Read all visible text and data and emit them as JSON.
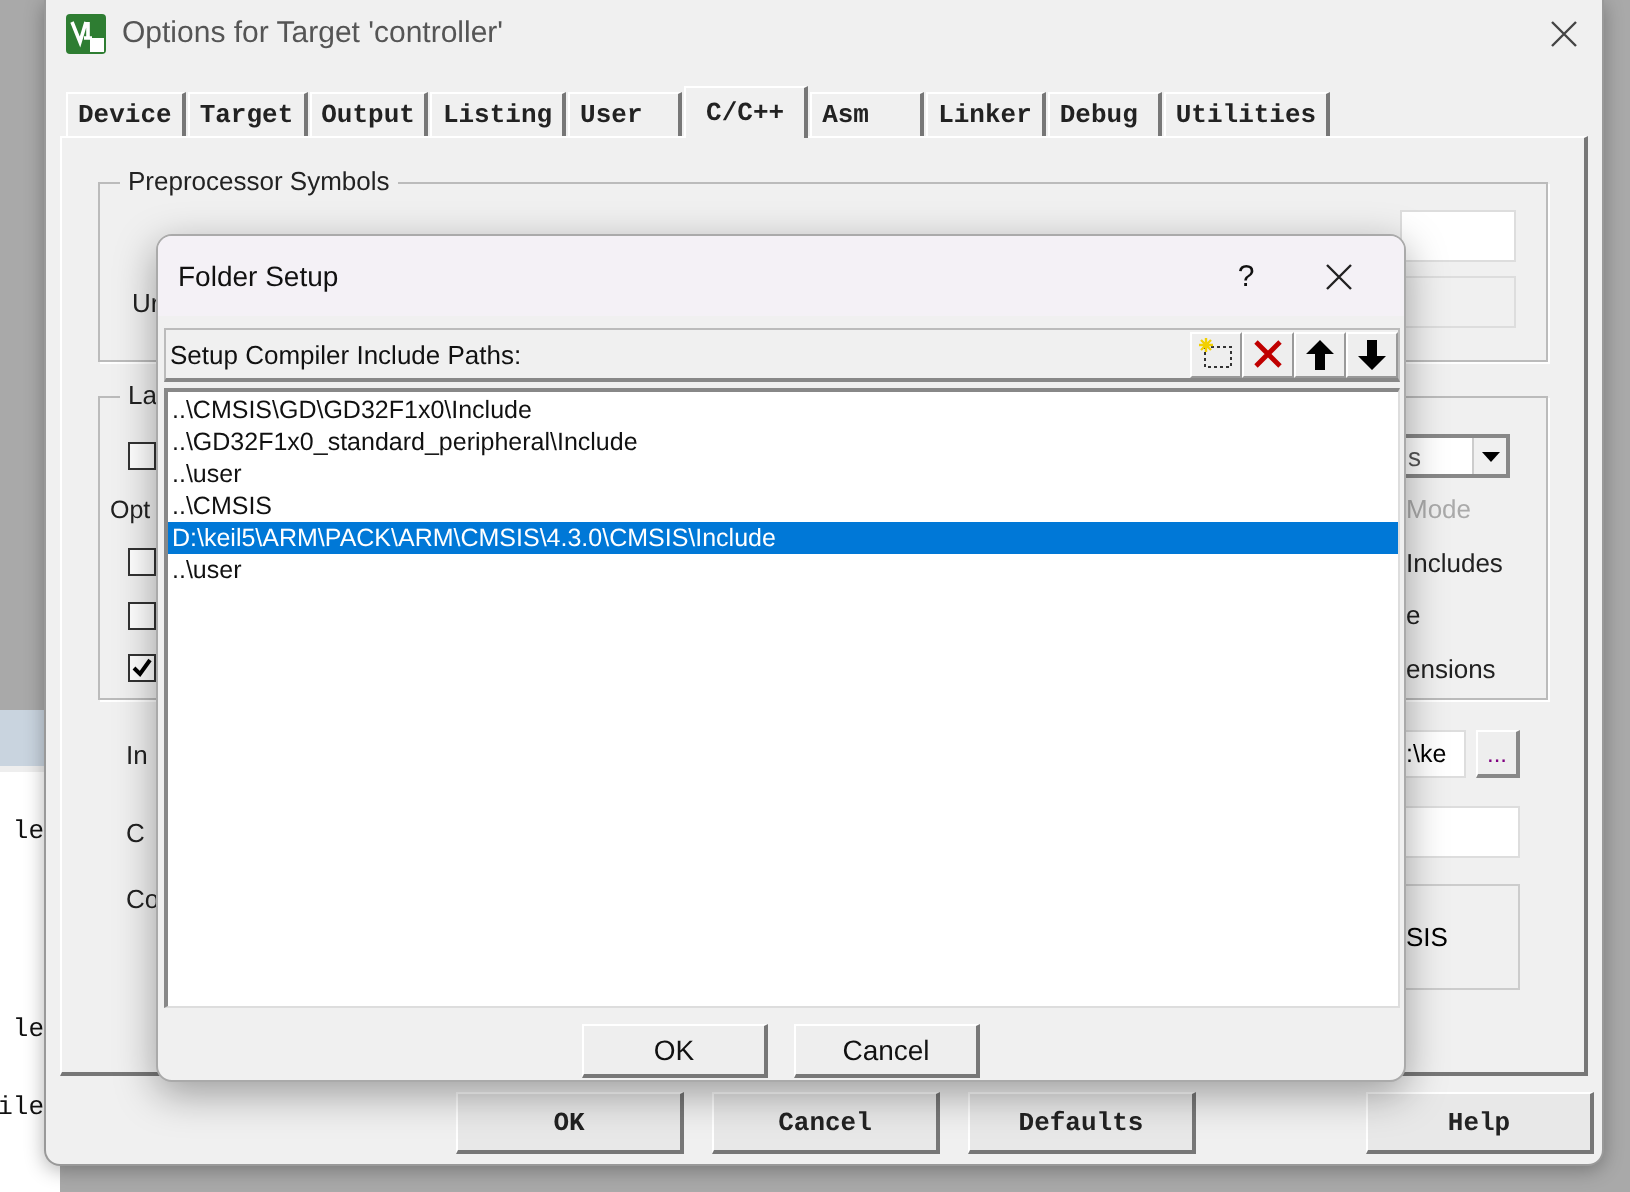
{
  "editor": {
    "lines": [
      "le",
      "le",
      "ile"
    ]
  },
  "window": {
    "title": "Options for Target 'controller'"
  },
  "tabs": [
    {
      "label": "Device",
      "selected": false
    },
    {
      "label": "Target",
      "selected": false
    },
    {
      "label": "Output",
      "selected": false
    },
    {
      "label": "Listing",
      "selected": false
    },
    {
      "label": "User",
      "selected": false
    },
    {
      "label": "C/C++",
      "selected": true
    },
    {
      "label": "Asm",
      "selected": false
    },
    {
      "label": "Linker",
      "selected": false
    },
    {
      "label": "Debug",
      "selected": false
    },
    {
      "label": "Utilities",
      "selected": false
    }
  ],
  "preprocessor_group": {
    "title": "Preprocessor Symbols",
    "row_label": "Ur"
  },
  "language_group": {
    "title": "La",
    "rows": [
      {
        "left": {
          "kind": "checkbox",
          "checked": false
        },
        "right": {
          "kind": "dropdown",
          "text": "s"
        }
      },
      {
        "left": {
          "kind": "label",
          "text": "Opt"
        },
        "right": {
          "kind": "label",
          "text": "Mode",
          "disabled": true
        }
      },
      {
        "left": {
          "kind": "checkbox",
          "checked": false
        },
        "right": {
          "kind": "label",
          "text": "Includes",
          "disabled": false
        }
      },
      {
        "left": {
          "kind": "checkbox",
          "checked": false
        },
        "right": {
          "kind": "label",
          "text": "e",
          "disabled": false
        }
      },
      {
        "left": {
          "kind": "checkbox",
          "checked": true
        },
        "right": {
          "kind": "label",
          "text": "ensions",
          "disabled": false
        }
      }
    ]
  },
  "include_row": {
    "label": "In",
    "value": ":\\ke",
    "browse": "..."
  },
  "misc_row": {
    "label": "C"
  },
  "controls_row": {
    "label": "Co",
    "value": "SIS"
  },
  "buttons": [
    "OK",
    "Cancel",
    "Defaults",
    "Help"
  ],
  "folder_dialog": {
    "title": "Folder Setup",
    "help": "?",
    "toolbar_label": "Setup Compiler Include Paths:",
    "paths": [
      {
        "text": "..\\CMSIS\\GD\\GD32F1x0\\Include",
        "selected": false
      },
      {
        "text": "..\\GD32F1x0_standard_peripheral\\Include",
        "selected": false
      },
      {
        "text": "..\\user",
        "selected": false
      },
      {
        "text": "..\\CMSIS",
        "selected": false
      },
      {
        "text": "D:\\keil5\\ARM\\PACK\\ARM\\CMSIS\\4.3.0\\CMSIS\\Include",
        "selected": true
      },
      {
        "text": "..\\user",
        "selected": false
      }
    ],
    "buttons": [
      "OK",
      "Cancel"
    ]
  }
}
